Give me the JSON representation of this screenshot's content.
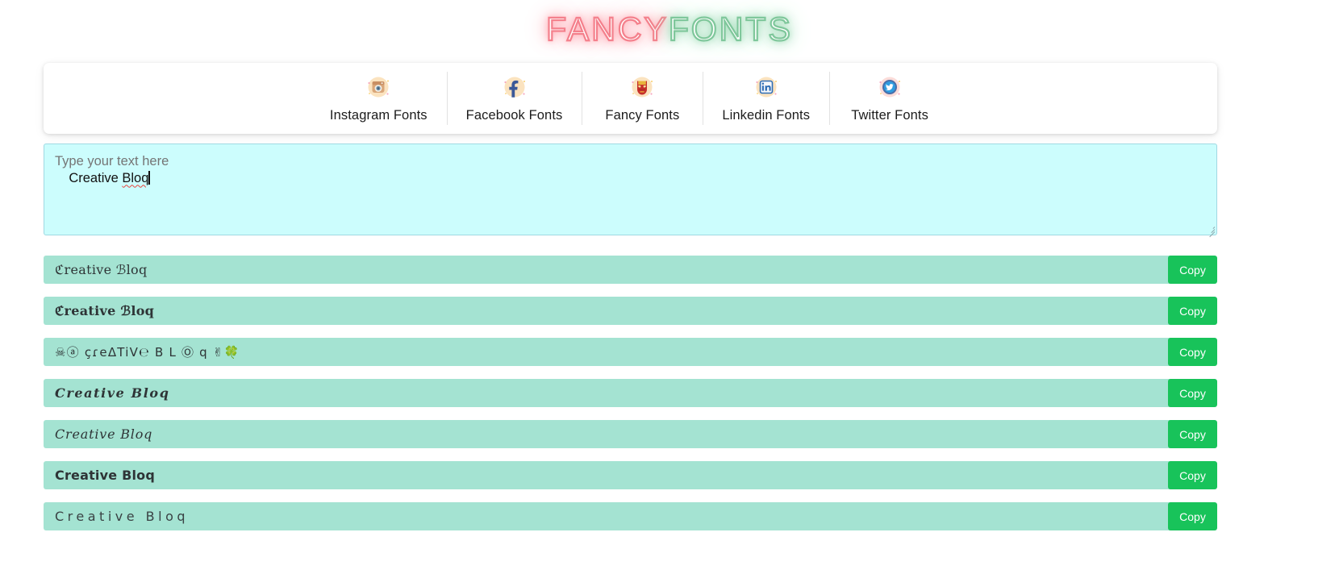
{
  "logo": {
    "part1": "FANCY",
    "part2": "FONTS",
    "color1": "#f4808c",
    "color2": "#7fc79b"
  },
  "nav": {
    "items": [
      {
        "label": "Instagram Fonts",
        "icon": "instagram-icon"
      },
      {
        "label": "Facebook Fonts",
        "icon": "facebook-icon"
      },
      {
        "label": "Fancy Fonts",
        "icon": "ironman-mask-icon"
      },
      {
        "label": "Linkedin Fonts",
        "icon": "linkedin-icon"
      },
      {
        "label": "Twitter Fonts",
        "icon": "twitter-bird-icon"
      }
    ]
  },
  "input": {
    "value": "Creative Bloq",
    "value_ok": "Creative ",
    "value_misspelled": "Bloq",
    "placeholder": "Type your text here",
    "background": "#ccfdfd"
  },
  "results": {
    "copy_label": "Copy",
    "copy_color": "#18c35a",
    "row_color": "#a4e3d2",
    "rows": [
      {
        "text": "ℭreative ℬloq",
        "style": "f-fraktur"
      },
      {
        "text": "ℭreative ℬloq",
        "style": "f-fraktur-b"
      },
      {
        "text": "☠ⓐ çɾеΔTiV℮ B L Ⓞ q ✌🍀",
        "style": "f-emoji"
      },
      {
        "text": "Creative Bloq",
        "style": "f-script-b"
      },
      {
        "text": "Creative Bloq",
        "style": "f-script"
      },
      {
        "text": "Creative Bloq",
        "style": "f-double"
      },
      {
        "text": "Creative Bloq",
        "style": "f-wide"
      }
    ]
  }
}
